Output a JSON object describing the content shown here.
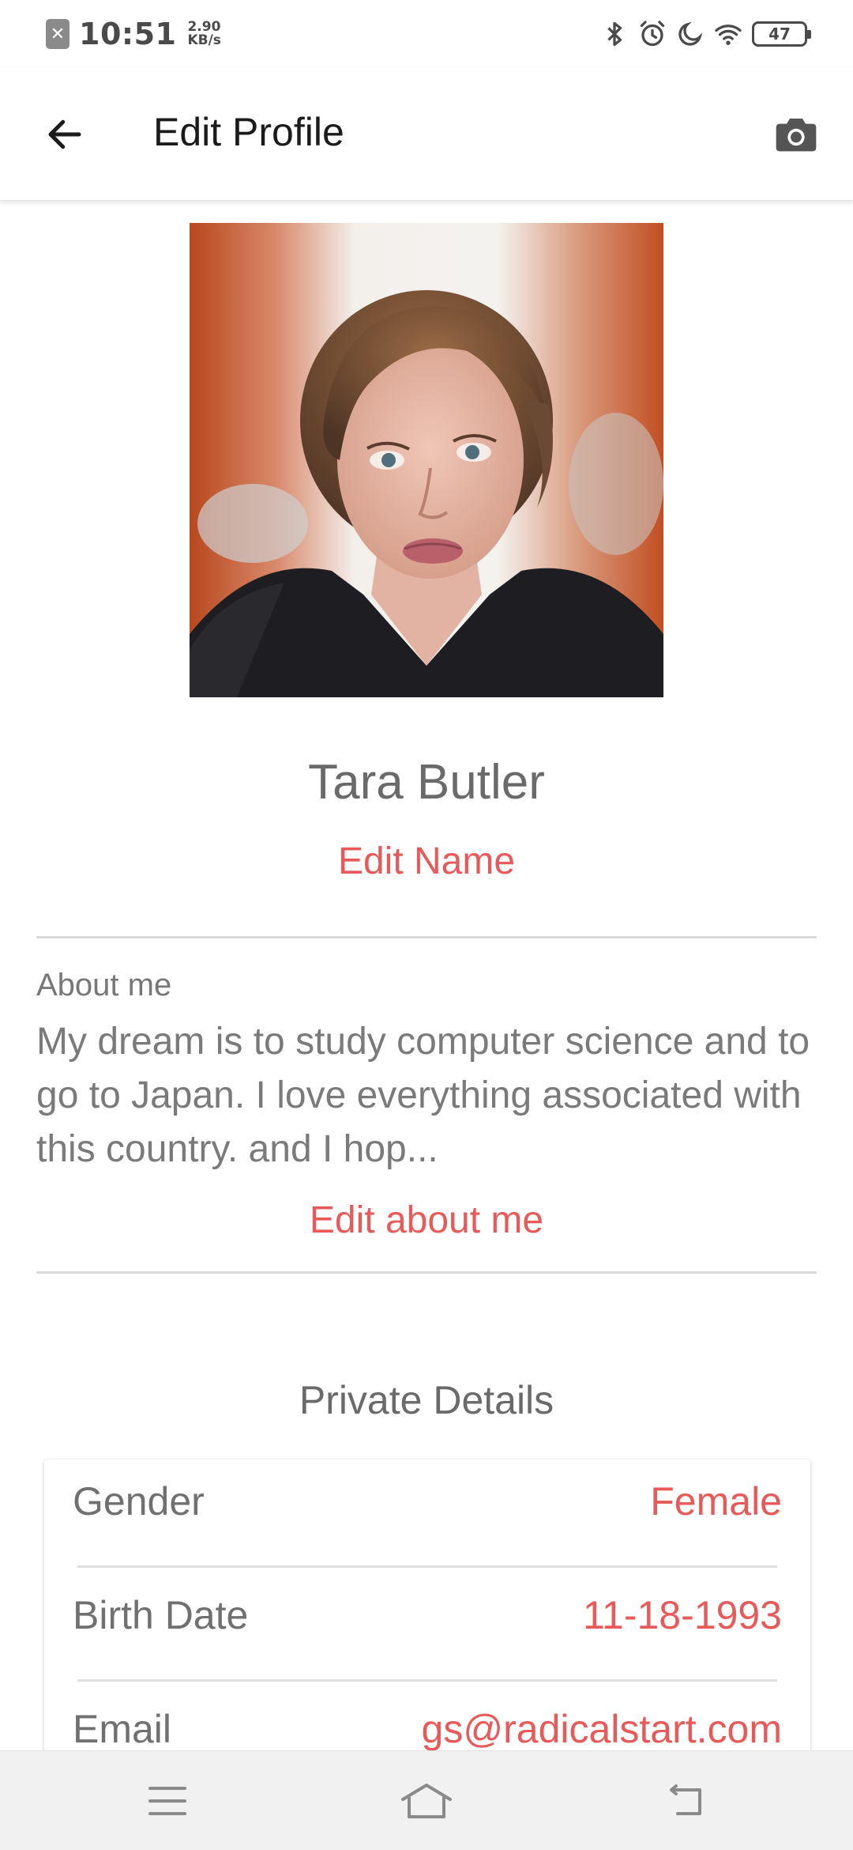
{
  "status_bar": {
    "time": "10:51",
    "net_speed_value": "2.90",
    "net_speed_unit": "KB/s",
    "battery_level": "47",
    "sim_icon_glyph": "✕",
    "icons": [
      "sim-off-icon",
      "bluetooth-icon",
      "alarm-icon",
      "moon-icon",
      "wifi-icon",
      "battery-icon"
    ]
  },
  "app_bar": {
    "title": "Edit Profile",
    "back_icon": "arrow-left-icon",
    "camera_icon": "camera-icon"
  },
  "profile": {
    "name": "Tara Butler",
    "edit_name_label": "Edit Name",
    "about_label": "About me",
    "about_text": "My dream is to study computer science and to go to Japan. I love everything associated with this country. and I hop...",
    "edit_about_label": "Edit about me"
  },
  "private_details": {
    "title": "Private Details",
    "rows": [
      {
        "label": "Gender",
        "value": "Female"
      },
      {
        "label": "Birth Date",
        "value": "11-18-1993"
      },
      {
        "label": "Email",
        "value": "gs@radicalstart.com"
      }
    ]
  },
  "nav_bar": {
    "icons": [
      "menu-icon",
      "home-icon",
      "back-icon"
    ]
  },
  "colors": {
    "accent": "#e85a5a",
    "text_primary": "#1b1b1b",
    "text_secondary": "#6f6f6f",
    "divider": "#d9d9d9",
    "nav_bg": "#f1f1f1"
  }
}
